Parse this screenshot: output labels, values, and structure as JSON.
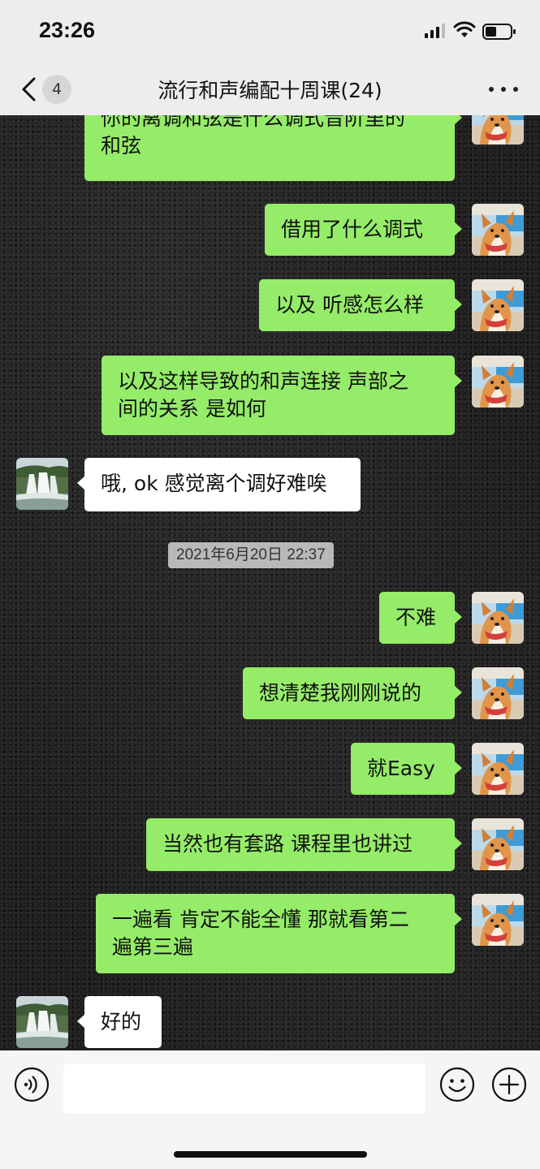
{
  "status_bar": {
    "time": "23:26"
  },
  "nav": {
    "back_badge": "4",
    "title": "流行和声编配十周课(24)"
  },
  "timestamp": "2021年6月20日 22:37",
  "messages_before": [
    {
      "side": "right",
      "text": "你的离调和弦是什么调式音阶里的\n和弦"
    },
    {
      "side": "right",
      "text": "借用了什么调式"
    },
    {
      "side": "right",
      "text": "以及 听感怎么样"
    },
    {
      "side": "right",
      "text": "以及这样导致的和声连接 声部之\n间的关系 是如何"
    },
    {
      "side": "left",
      "text": "哦, ok 感觉离个调好难唉"
    }
  ],
  "messages_after": [
    {
      "side": "right",
      "text": "不难"
    },
    {
      "side": "right",
      "text": "想清楚我刚刚说的"
    },
    {
      "side": "right",
      "text": "就Easy"
    },
    {
      "side": "right",
      "text": "当然也有套路 课程里也讲过"
    },
    {
      "side": "right",
      "text": "一遍看 肯定不能全懂 那就看第二\n遍第三遍"
    },
    {
      "side": "left",
      "text": "好的"
    }
  ],
  "input": {
    "value": "",
    "placeholder": ""
  },
  "icons": {
    "back": "chevron-left-icon",
    "more": "more-dots-icon",
    "voice": "voice-icon",
    "emoji": "emoji-icon",
    "plus": "plus-icon",
    "signal": "signal-icon",
    "wifi": "wifi-icon",
    "battery": "battery-icon"
  },
  "colors": {
    "sent_bubble": "#95ec69",
    "received_bubble": "#ffffff",
    "header_bg": "#ededed"
  }
}
